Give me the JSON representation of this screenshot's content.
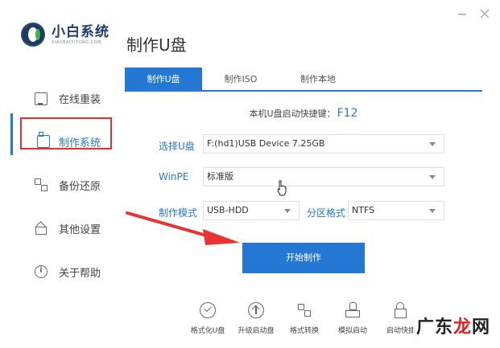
{
  "brand": {
    "name": "小白系统",
    "subtitle": "XIAOBAIXITONG.COM"
  },
  "sidebar": {
    "items": [
      {
        "label": "在线重装",
        "icon": "monitor-icon"
      },
      {
        "label": "制作系统",
        "icon": "usb-icon",
        "active": true
      },
      {
        "label": "备份还原",
        "icon": "grid-icon"
      },
      {
        "label": "其他设置",
        "icon": "home-icon"
      },
      {
        "label": "关于帮助",
        "icon": "info-icon"
      }
    ]
  },
  "main": {
    "title": "制作U盘",
    "tabs": [
      {
        "label": "制作U盘",
        "active": true
      },
      {
        "label": "制作ISO"
      },
      {
        "label": "制作本地"
      }
    ],
    "hotkey_label": "本机U盘启动快捷键：",
    "hotkey_value": "F12",
    "usb_label": "选择U盘",
    "usb_value": "F:(hd1)USB Device 7.25GB",
    "winpe_label": "WinPE",
    "winpe_value": "标准版",
    "mode_label": "制作模式",
    "mode_value": "USB-HDD",
    "partition_label": "分区格式",
    "partition_value": "NTFS",
    "start_button": "开始制作"
  },
  "tools": [
    {
      "label": "格式化U盘",
      "icon": "check-circle-icon"
    },
    {
      "label": "升级启动盘",
      "icon": "upgrade-icon"
    },
    {
      "label": "格式转换",
      "icon": "convert-icon"
    },
    {
      "label": "模拟启动",
      "icon": "stamp-icon"
    },
    {
      "label": "启动快捷",
      "icon": "lock-icon"
    }
  ],
  "watermark": {
    "text_main": "广东",
    "text_accent": "龙",
    "text_end": "网"
  },
  "colors": {
    "accent": "#2478d4",
    "highlight_box": "#e0322c",
    "arrow": "#e8332f"
  }
}
